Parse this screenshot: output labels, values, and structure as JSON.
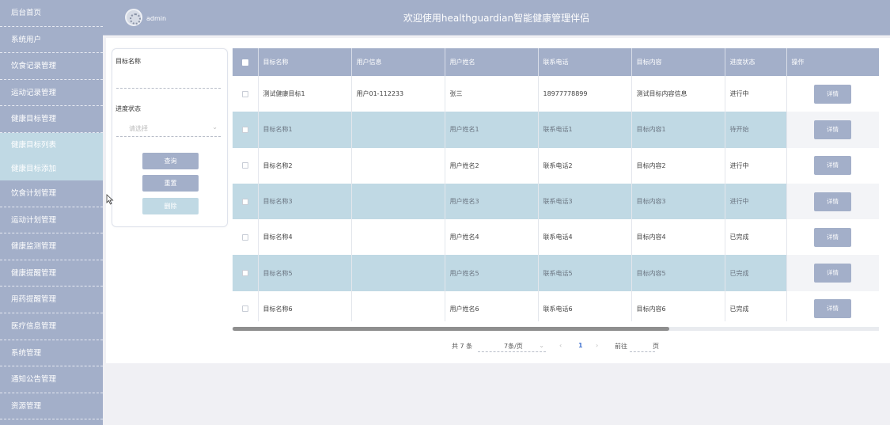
{
  "sidebar": {
    "items": [
      {
        "label": "后台首页"
      },
      {
        "label": "系统用户"
      },
      {
        "label": "饮食记录管理"
      },
      {
        "label": "运动记录管理"
      },
      {
        "label": "健康目标管理"
      },
      {
        "label": "健康目标列表"
      },
      {
        "label": "健康目标添加"
      },
      {
        "label": "饮食计划管理"
      },
      {
        "label": "运动计划管理"
      },
      {
        "label": "健康监测管理"
      },
      {
        "label": "健康提醒管理"
      },
      {
        "label": "用药提醒管理"
      },
      {
        "label": "医疗信息管理"
      },
      {
        "label": "系统管理"
      },
      {
        "label": "通知公告管理"
      },
      {
        "label": "资源管理"
      }
    ]
  },
  "header": {
    "user": "admin",
    "title": "欢迎使用healthguardian智能健康管理伴侣"
  },
  "search": {
    "name_label": "目标名称",
    "status_label": "进度状态",
    "status_placeholder": "请选择",
    "query_button": "查询",
    "reset_button": "重置",
    "delete_button": "删除"
  },
  "table": {
    "columns": [
      "目标名称",
      "用户信息",
      "用户姓名",
      "联系电话",
      "目标内容",
      "进度状态",
      "操作"
    ],
    "detail_label": "详情",
    "rows": [
      {
        "name": "测试健康目标1",
        "user_info": "用户01-112233",
        "user_name": "张三",
        "phone": "18977778899",
        "content": "测试目标内容信息",
        "status": "进行中"
      },
      {
        "name": "目标名称1",
        "user_info": "",
        "user_name": "用户姓名1",
        "phone": "联系电话1",
        "content": "目标内容1",
        "status": "待开始"
      },
      {
        "name": "目标名称2",
        "user_info": "",
        "user_name": "用户姓名2",
        "phone": "联系电话2",
        "content": "目标内容2",
        "status": "进行中"
      },
      {
        "name": "目标名称3",
        "user_info": "",
        "user_name": "用户姓名3",
        "phone": "联系电话3",
        "content": "目标内容3",
        "status": "进行中"
      },
      {
        "name": "目标名称4",
        "user_info": "",
        "user_name": "用户姓名4",
        "phone": "联系电话4",
        "content": "目标内容4",
        "status": "已完成"
      },
      {
        "name": "目标名称5",
        "user_info": "",
        "user_name": "用户姓名5",
        "phone": "联系电话5",
        "content": "目标内容5",
        "status": "已完成"
      },
      {
        "name": "目标名称6",
        "user_info": "",
        "user_name": "用户姓名6",
        "phone": "联系电话6",
        "content": "目标内容6",
        "status": "已完成"
      }
    ]
  },
  "pagination": {
    "total": "共 7 条",
    "page_size": "7条/页",
    "prev": "‹",
    "current": "1",
    "next": "›",
    "goto": "前往",
    "unit": "页"
  },
  "colors": {
    "sidebar_bg": "#a3afc9",
    "sidebar_active": "#4f6ea4",
    "sidebar_sub": "#c0d9e4",
    "row_alt": "#c0d9e4"
  }
}
